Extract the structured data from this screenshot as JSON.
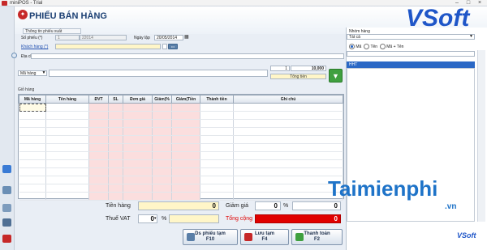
{
  "app": {
    "title": "miniPOS - Trial"
  },
  "header": {
    "title": "PHIẾU BÁN HÀNG"
  },
  "brand": {
    "logo_text": "VSoft",
    "footer_logo": "VSoft"
  },
  "watermark": {
    "text": "Taimienphi",
    "suffix": ".vn"
  },
  "form": {
    "tab_label": "Thông tin phiếu xuất",
    "so_phieu_label": "Số phiếu (*)",
    "so_phieu_prefix": "1",
    "so_phieu_value": "22014",
    "ngay_lap_label": "Ngày lập",
    "ngay_lap_value": "20/05/2014",
    "khach_hang_label": "Khách hàng (*)",
    "dia_chi_label": "Địa chỉ",
    "ma_hang_label": "Mã hàng",
    "quantity": "1",
    "price": "10,000",
    "tong_tien_label": "Tổng tiền"
  },
  "grid": {
    "title": "Giỏ hàng",
    "columns": [
      "Mã hàng",
      "Tên hàng",
      "ĐVT",
      "SL",
      "Đơn giá",
      "Giảm(%",
      "Giảm(Tiền",
      "Thành tiền",
      "Ghi chú"
    ]
  },
  "totals": {
    "tien_hang_label": "Tiền hàng",
    "tien_hang_value": "0",
    "thue_vat_label": "Thuế VAT",
    "thue_vat_value": "0",
    "thue_vat_unit": "%",
    "giam_gia_label": "Giảm giá",
    "giam_gia_pct": "0",
    "giam_gia_unit": "%",
    "giam_gia_value": "0",
    "tong_cong_label": "Tổng cộng",
    "tong_cong_value": "0"
  },
  "actions": {
    "ds_phieu_tam": "Ds phiếu tạm",
    "ds_phieu_tam_key": "F10",
    "luu_tam": "Lưu tạm",
    "luu_tam_key": "F4",
    "thanh_toan": "Thanh toán",
    "thanh_toan_key": "F2"
  },
  "right_panel": {
    "nhom_hang_label": "Nhóm hàng",
    "nhom_hang_value": "Tất cả",
    "radio_ma": "Mã",
    "radio_ten": "Tên",
    "radio_ma_ten": "Mã + Tên",
    "list_header": "HHT"
  },
  "colors": {
    "accent": "#2b68c5",
    "total_red": "#e00000",
    "pink_column": "#fbdede",
    "yellow_field": "#fff6c8"
  }
}
